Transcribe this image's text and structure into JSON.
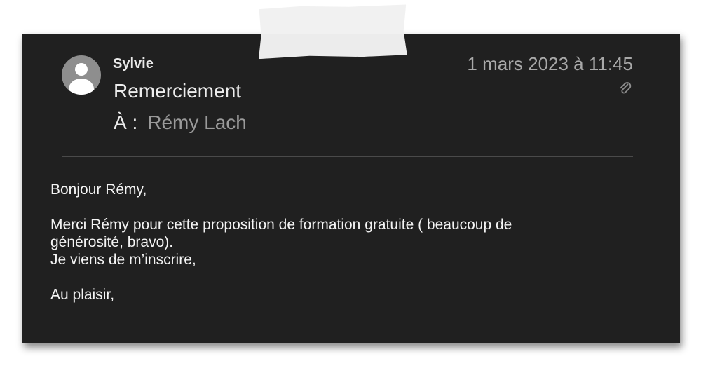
{
  "email": {
    "sender": "Sylvie",
    "subject": "Remerciement",
    "to_label": "À :",
    "recipient": "Rémy Lach",
    "date": "1 mars 2023 à 11:45",
    "attachment_icon": "paperclip-icon",
    "avatar_icon": "person-avatar-icon",
    "body": {
      "greeting": "Bonjour Rémy,",
      "line1": "Merci Rémy pour cette proposition de formation gratuite ( beaucoup de",
      "line2": "générosité, bravo).",
      "line3": "Je viens de m’inscrire,",
      "closing": "Au plaisir,"
    }
  },
  "colors": {
    "card_background": "#202020",
    "primary_text": "#ececec",
    "secondary_text": "#a8a8a8"
  }
}
